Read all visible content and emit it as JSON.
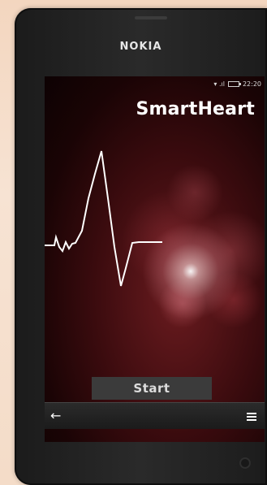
{
  "device": {
    "brand": "NOKIA"
  },
  "status": {
    "time": "22:20"
  },
  "app": {
    "title": "SmartHeart"
  },
  "buttons": {
    "start_label": "Start"
  },
  "toolbar": {
    "back_icon": "back-arrow-icon",
    "menu_icon": "menu-icon"
  },
  "colors": {
    "accent": "#7a1d22",
    "screen_bg": "#1a0405",
    "button_bg": "#3b3b3b"
  }
}
